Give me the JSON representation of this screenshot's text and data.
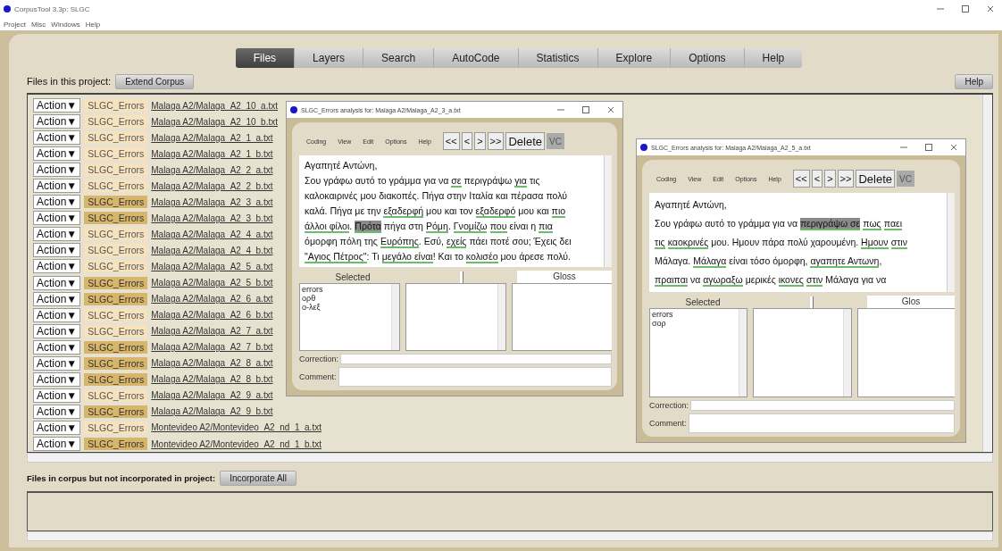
{
  "app": {
    "title": "CorpusTool 3.3p: SLGC"
  },
  "menu": [
    "Project",
    "Misc",
    "Windows",
    "Help"
  ],
  "tabs": [
    {
      "label": "Files",
      "selected": true
    },
    {
      "label": "Layers",
      "selected": false
    },
    {
      "label": "Search",
      "selected": false
    },
    {
      "label": "AutoCode",
      "selected": false
    },
    {
      "label": "Statistics",
      "selected": false
    },
    {
      "label": "Explore",
      "selected": false
    },
    {
      "label": "Options",
      "selected": false
    },
    {
      "label": "Help",
      "selected": false
    }
  ],
  "files_section": {
    "label": "Files in this project:",
    "button": "Extend Corpus",
    "help_button": "Help",
    "rows": [
      {
        "action": "Action▼",
        "layer": "SLGC_Errors",
        "highlighted": false,
        "file": "Malaga A2/Malaga_A2_10_a.txt"
      },
      {
        "action": "Action▼",
        "layer": "SLGC_Errors",
        "highlighted": false,
        "file": "Malaga A2/Malaga_A2_10_b.txt"
      },
      {
        "action": "Action▼",
        "layer": "SLGC_Errors",
        "highlighted": false,
        "file": "Malaga A2/Malaga_A2_1_a.txt"
      },
      {
        "action": "Action▼",
        "layer": "SLGC_Errors",
        "highlighted": false,
        "file": "Malaga A2/Malaga_A2_1_b.txt"
      },
      {
        "action": "Action▼",
        "layer": "SLGC_Errors",
        "highlighted": false,
        "file": "Malaga A2/Malaga_A2_2_a.txt"
      },
      {
        "action": "Action▼",
        "layer": "SLGC_Errors",
        "highlighted": false,
        "file": "Malaga A2/Malaga_A2_2_b.txt"
      },
      {
        "action": "Action▼",
        "layer": "SLGC_Errors",
        "highlighted": true,
        "file": "Malaga A2/Malaga_A2_3_a.txt"
      },
      {
        "action": "Action▼",
        "layer": "SLGC_Errors",
        "highlighted": true,
        "file": "Malaga A2/Malaga_A2_3_b.txt"
      },
      {
        "action": "Action▼",
        "layer": "SLGC_Errors",
        "highlighted": false,
        "file": "Malaga A2/Malaga_A2_4_a.txt"
      },
      {
        "action": "Action▼",
        "layer": "SLGC_Errors",
        "highlighted": false,
        "file": "Malaga A2/Malaga_A2_4_b.txt"
      },
      {
        "action": "Action▼",
        "layer": "SLGC_Errors",
        "highlighted": false,
        "file": "Malaga A2/Malaga_A2_5_a.txt"
      },
      {
        "action": "Action▼",
        "layer": "SLGC_Errors",
        "highlighted": true,
        "file": "Malaga A2/Malaga_A2_5_b.txt"
      },
      {
        "action": "Action▼",
        "layer": "SLGC_Errors",
        "highlighted": true,
        "file": "Malaga A2/Malaga_A2_6_a.txt"
      },
      {
        "action": "Action▼",
        "layer": "SLGC_Errors",
        "highlighted": false,
        "file": "Malaga A2/Malaga_A2_6_b.txt"
      },
      {
        "action": "Action▼",
        "layer": "SLGC_Errors",
        "highlighted": false,
        "file": "Malaga A2/Malaga_A2_7_a.txt"
      },
      {
        "action": "Action▼",
        "layer": "SLGC_Errors",
        "highlighted": true,
        "file": "Malaga A2/Malaga_A2_7_b.txt"
      },
      {
        "action": "Action▼",
        "layer": "SLGC_Errors",
        "highlighted": true,
        "file": "Malaga A2/Malaga_A2_8_a.txt"
      },
      {
        "action": "Action▼",
        "layer": "SLGC_Errors",
        "highlighted": true,
        "file": "Malaga A2/Malaga_A2_8_b.txt"
      },
      {
        "action": "Action▼",
        "layer": "SLGC_Errors",
        "highlighted": false,
        "file": "Malaga A2/Malaga_A2_9_a.txt"
      },
      {
        "action": "Action▼",
        "layer": "SLGC_Errors",
        "highlighted": true,
        "file": "Malaga A2/Malaga_A2_9_b.txt"
      },
      {
        "action": "Action▼",
        "layer": "SLGC_Errors",
        "highlighted": false,
        "file": "Montevideo A2/Montevideo_A2_nd_1_a.txt"
      },
      {
        "action": "Action▼",
        "layer": "SLGC_Errors",
        "highlighted": true,
        "file": "Montevideo A2/Montevideo_A2_nd_1_b.txt"
      }
    ]
  },
  "unincorporated": {
    "label": "Files in corpus but not incorporated in project:",
    "button": "Incorporate All"
  },
  "windows": [
    {
      "title": "SLGC_Errors analysis for: Malaga A2/Malaga_A2_3_a.txt",
      "menu": [
        "Coding",
        "View",
        "Edit",
        "Options",
        "Help"
      ],
      "nav_buttons": [
        "<<",
        "<",
        ">",
        ">>"
      ],
      "delete": "Delete",
      "vc": "VC",
      "lines": [
        [
          {
            "text": "Αγαπητέ Αντώνη,",
            "kind": "plain"
          }
        ],
        [
          {
            "text": "Σου γράφω αυτό το γράμμα για να ",
            "kind": "plain"
          },
          {
            "text": "σε",
            "kind": "coded"
          },
          {
            "text": " περιγράψω ",
            "kind": "plain"
          },
          {
            "text": "για",
            "kind": "coded"
          },
          {
            "text": " τις",
            "kind": "plain"
          }
        ],
        [
          {
            "text": "καλοκαιρινές μου διακοπές. Πήγα στην Ιταλία και πέρασα πολύ",
            "kind": "plain"
          }
        ],
        [
          {
            "text": "καλά. Πήγα με την ",
            "kind": "plain"
          },
          {
            "text": "εξαδερφή",
            "kind": "coded"
          },
          {
            "text": " μου και τον ",
            "kind": "plain"
          },
          {
            "text": "εξαδερφό",
            "kind": "coded"
          },
          {
            "text": " μου και ",
            "kind": "plain"
          },
          {
            "text": "πιο",
            "kind": "coded"
          }
        ],
        [
          {
            "text": "άλλοι φίλοι",
            "kind": "coded"
          },
          {
            "text": ". ",
            "kind": "plain"
          },
          {
            "text": "Πρότα",
            "kind": "selected"
          },
          {
            "text": " πήγα στη ",
            "kind": "plain"
          },
          {
            "text": "Ρόμη",
            "kind": "coded"
          },
          {
            "text": ". ",
            "kind": "plain"
          },
          {
            "text": "Γνομίζω",
            "kind": "coded",
            "space_after": true
          },
          {
            "text": "που",
            "kind": "coded"
          },
          {
            "text": " είναι η ",
            "kind": "plain"
          },
          {
            "text": "πια",
            "kind": "coded"
          }
        ],
        [
          {
            "text": "όμορφη πόλη της ",
            "kind": "plain"
          },
          {
            "text": "Ευρόπης",
            "kind": "coded"
          },
          {
            "text": ". Εσύ, ",
            "kind": "plain"
          },
          {
            "text": "εχείς",
            "kind": "coded"
          },
          {
            "text": " πάει ποτέ σου; Έχεις δει",
            "kind": "plain"
          }
        ],
        [
          {
            "text": "\"Αγιος Πέτρος\"",
            "kind": "coded"
          },
          {
            "text": ": Τι ",
            "kind": "plain"
          },
          {
            "text": "μεγάλο είναι",
            "kind": "coded"
          },
          {
            "text": "! Και το ",
            "kind": "plain"
          },
          {
            "text": "κολισέο",
            "kind": "coded"
          },
          {
            "text": " μου άρεσε πολύ.",
            "kind": "plain"
          }
        ]
      ],
      "selected_header": "Selected",
      "gloss_header": "Gloss",
      "codes": [
        "errors",
        "ορθ",
        "ο-λεξ"
      ],
      "correction_label": "Correction:",
      "comment_label": "Comment:"
    },
    {
      "title": "SLGC_Errors analysis for: Malaga A2/Malaga_A2_5_a.txt",
      "menu": [
        "Coding",
        "View",
        "Edit",
        "Options",
        "Help"
      ],
      "nav_buttons": [
        "<<",
        "<",
        ">",
        ">>"
      ],
      "delete": "Delete",
      "vc": "VC",
      "lines": [
        [
          {
            "text": "Αγαπητέ Αντώνη,",
            "kind": "plain"
          }
        ],
        [
          {
            "text": "Σου γράφω αυτό το γράμμα για να ",
            "kind": "plain"
          },
          {
            "text": "περιγράψω σε",
            "kind": "selected",
            "space_after": true
          },
          {
            "text": "πως",
            "kind": "coded",
            "space_after": true
          },
          {
            "text": "παει",
            "kind": "coded"
          }
        ],
        [
          {
            "text": "τις",
            "kind": "coded",
            "space_after": true
          },
          {
            "text": "καοκρινές",
            "kind": "coded"
          },
          {
            "text": " μου. Ημουν πάρα πολύ χαρουμένη. ",
            "kind": "plain"
          },
          {
            "text": "Ημουν",
            "kind": "coded",
            "space_after": true
          },
          {
            "text": "στιν",
            "kind": "coded"
          }
        ],
        [
          {
            "text": "Μάλαγα. ",
            "kind": "plain"
          },
          {
            "text": "Μάλαγα",
            "kind": "coded"
          },
          {
            "text": " είναι τόσο όμορφη, ",
            "kind": "plain"
          },
          {
            "text": "αγαπητε Αντωνη",
            "kind": "coded"
          },
          {
            "text": ",",
            "kind": "plain"
          }
        ],
        [
          {
            "text": "πραιπαι",
            "kind": "coded"
          },
          {
            "text": " να ",
            "kind": "plain"
          },
          {
            "text": "αγωραξω",
            "kind": "coded"
          },
          {
            "text": " μερικές ",
            "kind": "plain"
          },
          {
            "text": "ικονες",
            "kind": "coded",
            "space_after": true
          },
          {
            "text": "στιν",
            "kind": "coded"
          },
          {
            "text": " Μάλαγα για να",
            "kind": "plain"
          }
        ]
      ],
      "selected_header": "Selected",
      "gloss_header": "Glos",
      "codes": [
        "errors",
        "σορ"
      ],
      "correction_label": "Correction:",
      "comment_label": "Comment:"
    }
  ]
}
